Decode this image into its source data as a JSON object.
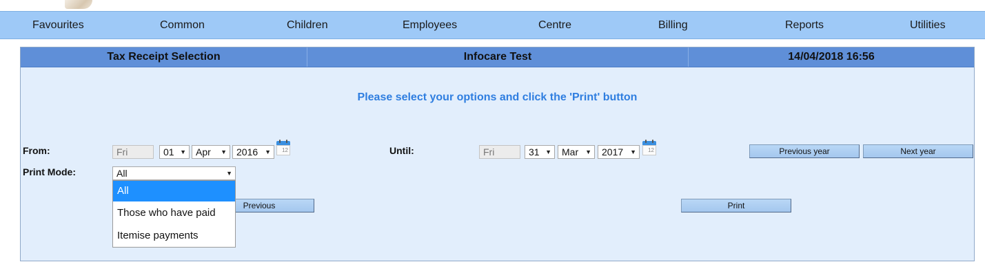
{
  "menu": [
    "Favourites",
    "Common",
    "Children",
    "Employees",
    "Centre",
    "Billing",
    "Reports",
    "Utilities"
  ],
  "header": {
    "title": "Tax Receipt Selection",
    "centre": "Infocare Test",
    "datetime": "14/04/2018 16:56"
  },
  "instruction": "Please select your options and click the 'Print' button",
  "from": {
    "label": "From:",
    "weekday": "Fri",
    "day": "01",
    "month": "Apr",
    "year": "2016",
    "calendar_icon_text": "12"
  },
  "until": {
    "label": "Until:",
    "weekday": "Fri",
    "day": "31",
    "month": "Mar",
    "year": "2017",
    "calendar_icon_text": "12"
  },
  "buttons": {
    "previous_year": "Previous year",
    "next_year": "Next year",
    "previous": "Previous",
    "print": "Print"
  },
  "print_mode": {
    "label": "Print Mode:",
    "selected": "All",
    "options": [
      "All",
      "Those who have paid",
      "Itemise payments"
    ]
  },
  "colors": {
    "menubar": "#9ec9f7",
    "header": "#5f8fd8",
    "panel": "#e2eefc",
    "instruction": "#2f7ee0",
    "highlight": "#1e90ff"
  }
}
